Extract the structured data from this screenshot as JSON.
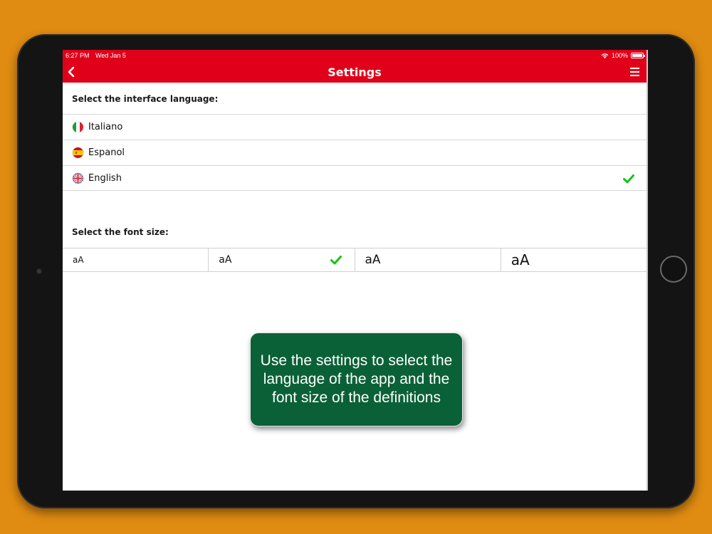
{
  "status_bar": {
    "time": "6:27 PM",
    "date": "Wed Jan 5",
    "battery": "100%"
  },
  "nav": {
    "title": "Settings",
    "back_icon": "chevron-left-icon",
    "menu_icon": "hamburger-menu-icon"
  },
  "language_section": {
    "label": "Select the interface language:",
    "options": [
      {
        "label": "Italiano",
        "flag": "italy-flag-icon",
        "selected": false
      },
      {
        "label": "Espanol",
        "flag": "spain-flag-icon",
        "selected": false
      },
      {
        "label": "English",
        "flag": "uk-flag-icon",
        "selected": true
      }
    ]
  },
  "font_section": {
    "label": "Select the font size:",
    "options": [
      {
        "label": "aA",
        "selected": false
      },
      {
        "label": "aA",
        "selected": true
      },
      {
        "label": "aA",
        "selected": false
      },
      {
        "label": "aA",
        "selected": false
      }
    ]
  },
  "callout": {
    "text": "Use the settings to select the language of the app and the font size of the definitions"
  },
  "colors": {
    "background": "#e08c12",
    "nav_bar": "#e0001a",
    "check": "#16c216",
    "callout": "#0b6137"
  }
}
